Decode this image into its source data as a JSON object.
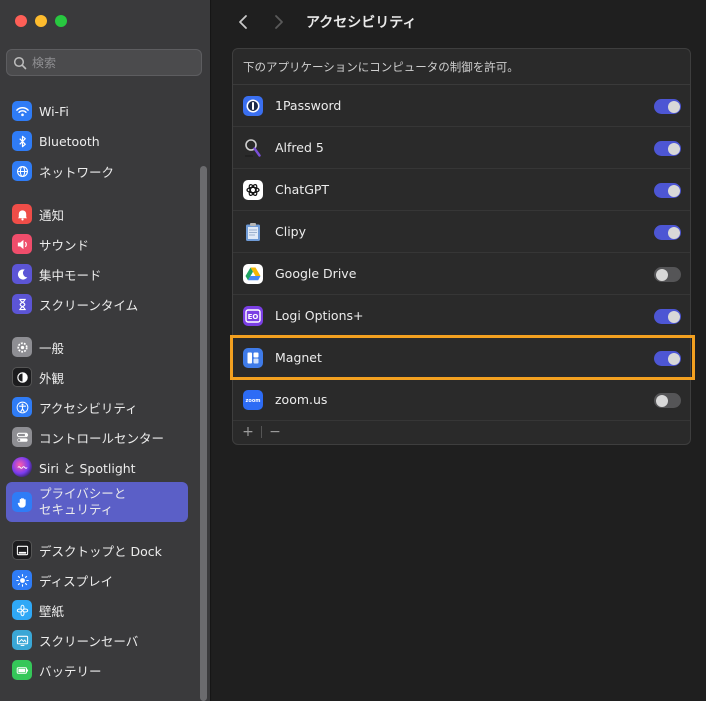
{
  "sidebar": {
    "search_placeholder": "検索",
    "items": [
      {
        "label": "Wi-Fi",
        "icon": "wifi-icon",
        "color": "#2f7cf6"
      },
      {
        "label": "Bluetooth",
        "icon": "bluetooth-icon",
        "color": "#2f7cf6"
      },
      {
        "label": "ネットワーク",
        "icon": "globe-icon",
        "color": "#2f7cf6"
      },
      {
        "label": "通知",
        "icon": "bell-icon",
        "color": "#ef4d48"
      },
      {
        "label": "サウンド",
        "icon": "speaker-icon",
        "color": "#ef4d6b"
      },
      {
        "label": "集中モード",
        "icon": "moon-icon",
        "color": "#5c55d6"
      },
      {
        "label": "スクリーンタイム",
        "icon": "hourglass-icon",
        "color": "#5c55d6"
      },
      {
        "label": "一般",
        "icon": "gear-icon",
        "color": "#8e8e93"
      },
      {
        "label": "外観",
        "icon": "appearance-icon",
        "color": "#1c1c1e"
      },
      {
        "label": "アクセシビリティ",
        "icon": "accessibility-icon",
        "color": "#2f7cf6"
      },
      {
        "label": "コントロールセンター",
        "icon": "switches-icon",
        "color": "#8e8e93"
      },
      {
        "label": "Siri と Spotlight",
        "icon": "siri-icon",
        "color": "#222"
      },
      {
        "label": "プライバシーと\nセキュリティ",
        "icon": "hand-icon",
        "color": "#2f7cf6"
      },
      {
        "label": "デスクトップと Dock",
        "icon": "dock-icon",
        "color": "#1c1c1e"
      },
      {
        "label": "ディスプレイ",
        "icon": "sun-icon",
        "color": "#2f7cf6"
      },
      {
        "label": "壁紙",
        "icon": "flower-icon",
        "color": "#2fa8f6"
      },
      {
        "label": "スクリーンセーバ",
        "icon": "screensaver-icon",
        "color": "#3aa7d6"
      },
      {
        "label": "バッテリー",
        "icon": "battery-icon",
        "color": "#35c759"
      }
    ]
  },
  "toolbar": {
    "title": "アクセシビリティ"
  },
  "panel": {
    "header": "下のアプリケーションにコンピュータの制御を許可。",
    "apps": [
      {
        "name": "1Password",
        "icon": "onepassword-icon",
        "enabled": true
      },
      {
        "name": "Alfred 5",
        "icon": "alfred-icon",
        "enabled": true
      },
      {
        "name": "ChatGPT",
        "icon": "chatgpt-icon",
        "enabled": true
      },
      {
        "name": "Clipy",
        "icon": "clipy-icon",
        "enabled": true
      },
      {
        "name": "Google Drive",
        "icon": "google-drive-icon",
        "enabled": false
      },
      {
        "name": "Logi Options+",
        "icon": "logi-icon",
        "enabled": true
      },
      {
        "name": "Magnet",
        "icon": "magnet-icon",
        "enabled": true
      },
      {
        "name": "zoom.us",
        "icon": "zoom-icon",
        "enabled": false
      }
    ],
    "add_label": "+",
    "remove_label": "−"
  },
  "colors": {
    "accent": "#5b5fc7",
    "toggle_on": "#4d56d4",
    "highlight": "#f3a020"
  }
}
